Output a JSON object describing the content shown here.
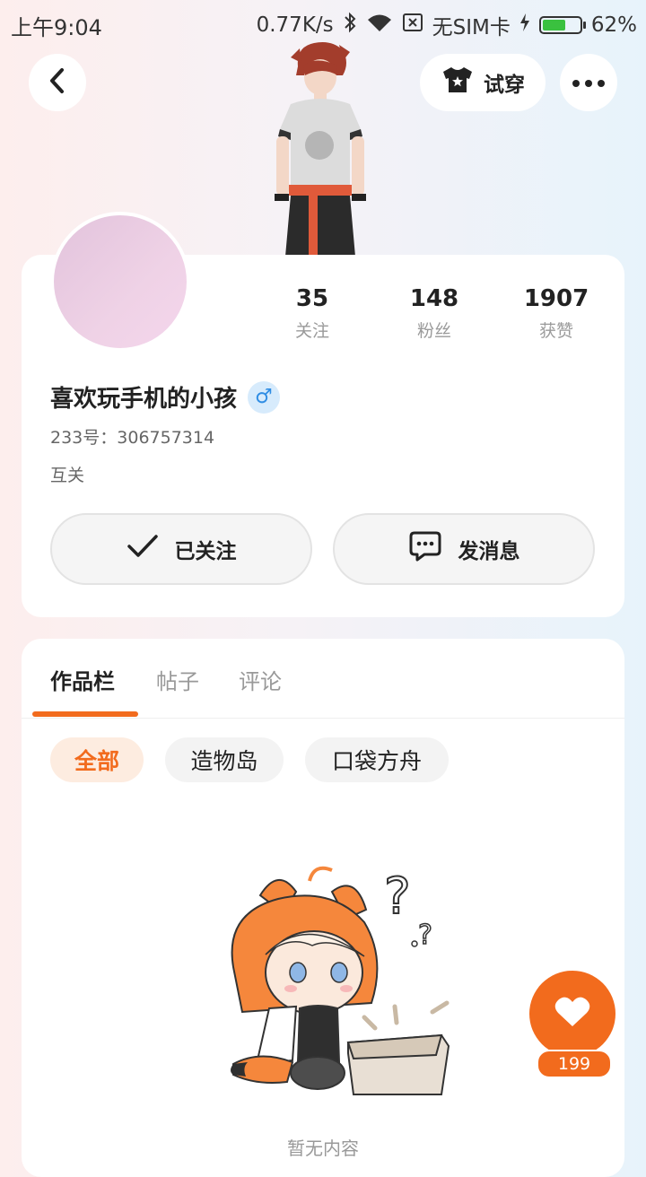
{
  "status_bar": {
    "time": "上午9:04",
    "net_speed": "0.77K/s",
    "carrier": "无SIM卡",
    "battery_percent": "62%",
    "battery_level": 0.62
  },
  "header": {
    "tryon_label": "试穿"
  },
  "profile": {
    "stats": [
      {
        "value": "35",
        "label": "关注"
      },
      {
        "value": "148",
        "label": "粉丝"
      },
      {
        "value": "1907",
        "label": "获赞"
      }
    ],
    "username": "喜欢玩手机的小孩",
    "gender_symbol": "♂",
    "uid": "233号：306757314",
    "relation": "互关",
    "follow_label": "已关注",
    "message_label": "发消息"
  },
  "works": {
    "tabs": [
      {
        "label": "作品栏",
        "active": true
      },
      {
        "label": "帖子",
        "active": false
      },
      {
        "label": "评论",
        "active": false
      }
    ],
    "filters": [
      {
        "label": "全部",
        "active": true
      },
      {
        "label": "造物岛",
        "active": false
      },
      {
        "label": "口袋方舟",
        "active": false
      }
    ],
    "empty_text": "暂无内容"
  },
  "like": {
    "count": "199"
  },
  "colors": {
    "accent": "#f26b1d",
    "gender_badge": "#2f8de4",
    "battery_fill": "#3ac13f"
  },
  "icons": [
    "back-icon",
    "shirt-icon",
    "more-icon",
    "check-icon",
    "chat-icon",
    "heart-icon",
    "bluetooth-icon",
    "wifi-icon",
    "sim-icon",
    "charging-icon"
  ]
}
